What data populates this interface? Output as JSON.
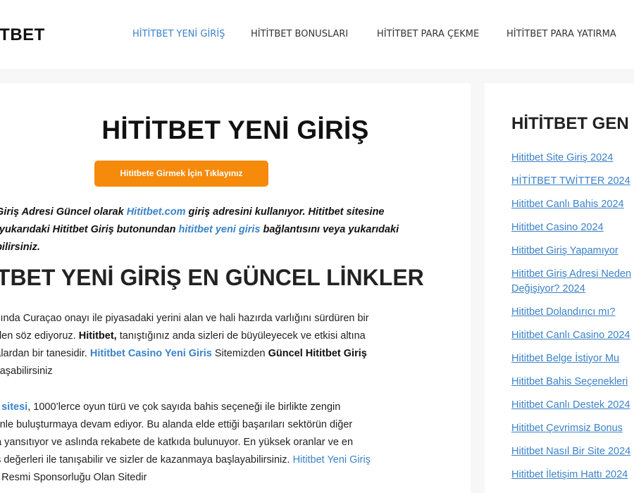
{
  "header": {
    "logo": "ITBET",
    "nav": [
      {
        "label": "HİTİTBET YENİ GİRİŞ",
        "active": true
      },
      {
        "label": "HİTİTBET BONUSLARI",
        "active": false
      },
      {
        "label": "HİTİTBET PARA ÇEKME",
        "active": false
      },
      {
        "label": "HİTİTBET PARA YATIRMA",
        "active": false
      }
    ]
  },
  "main": {
    "title": "HİTİTBET YENİ GİRİŞ",
    "cta_label": "Hititbete Girmek İçin Tıklayınız",
    "intro": {
      "line1_a": "i Giriş Adresi Güncel olarak ",
      "line1_link": "Hititbet.com",
      "line1_b": " giriş adresini kullanıyor. Hititbet sitesine",
      "line2_a": "n yukarıdaki Hititbet Giriş butonundan ",
      "line2_link": "hititbet yeni giris",
      "line2_b": " bağlantısını veya yukarıdaki",
      "line3": "abilirsiniz."
    },
    "heading2": "İTBET YENİ GİRİŞ EN GÜNCEL LİNKLER",
    "p1": {
      "l1": " yılında Curaçao onayı ile piyasadaki yerini alan ve hali hazırda varlığını sürdüren bir",
      "l2_a": "nden söz ediyoruz. ",
      "l2_bold": "Hititbet,",
      "l2_b": " tanıştığınız anda sizleri de büyüleyecek ve etkisi altına",
      "l3_a": "kalardan bir tanesidir. ",
      "l3_link": "Hititbet Casino Yeni Giris",
      "l3_b": " Sitemizden ",
      "l3_bold": "Güncel Hititbet Giriş",
      "l4": "Ulaşabilirsiniz"
    },
    "p2": {
      "l1_link": "is sitesi",
      "l1_b": ", 1000’lerce oyun türü ve çok sayıda bahis seçeneği ile birlikte zengin",
      "l2": "izinle buluşturmaya devam ediyor. Bu alanda elde ettiği başarıları sektörün diğer",
      "l3": "da yansıtıyor ve aslında rekabete de katkıda bulunuyor. En yüksek oranlar ve en",
      "l4_a": "us değerleri ile tanışabilir ve sizler de kazanmaya başlayabilirsiniz. ",
      "l4_link": "Hititbet Yeni Giriş",
      "l5": "et Resmi Sponsorluğu Olan Sitedir"
    }
  },
  "sidebar": {
    "title": "HİTİTBET GEN",
    "links": [
      "Hititbet Site Giriş 2024",
      "HİTİTBET TWİTTER 2024",
      "Hititbet Canlı Bahis 2024",
      "Hititbet Casino 2024",
      "Hititbet Giriş Yapamıyor",
      "Hititbet Giriş Adresi Neden Değişiyor? 2024",
      "Hititbet Dolandırıcı mı?",
      "Hititbet Canlı Casino 2024",
      "Hititbet Belge İstiyor Mu",
      "Hititbet Bahis Seçenekleri",
      "Hititbet Canlı Destek 2024",
      "Hititbet Çevrimsiz Bonus",
      "Hititbet Nasıl Bir Site 2024",
      "Hititbet İletişim Hattı 2024"
    ]
  },
  "colors": {
    "accent": "#3b82c9",
    "cta": "#f58a0b",
    "background": "#f7f7f7"
  }
}
